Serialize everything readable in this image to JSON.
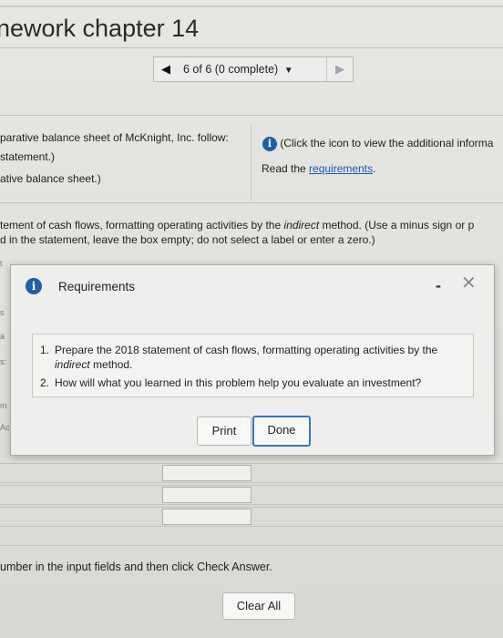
{
  "header": {
    "title": "nework chapter 14"
  },
  "nav": {
    "position": "6 of 6 (0 complete)",
    "prev_icon": "triangle-left",
    "next_icon": "triangle-right",
    "caret_icon": "caret-down"
  },
  "info": {
    "left_line1": "parative balance sheet of McKnight, Inc. follow:",
    "left_line2": "statement.)",
    "left_line3": "ative balance sheet.)",
    "right_line1": "(Click the icon to view the additional informa",
    "right_line2_prefix": "Read the ",
    "right_link": "requirements",
    "right_line2_suffix": "."
  },
  "instructions": {
    "line1_a": "tement of cash flows, formatting operating activities by the ",
    "line1_em": "indirect",
    "line1_b": " method. (Use a minus sign or p",
    "line2": "d in the statement, leave the box empty; do not select a label or enter a zero.)"
  },
  "left_stubs": {
    "s1": "t",
    "s2": "s",
    "s3": "a",
    "s4": "s:",
    "s5": "m",
    "s6": "Ac"
  },
  "modal": {
    "title": "Requirements",
    "minimize": "-",
    "close": "✕",
    "requirements": [
      {
        "num": "1.",
        "text_a": "Prepare the 2018 statement of cash flows, formatting operating activities by the ",
        "em": "indirect",
        "text_b": " method."
      },
      {
        "num": "2.",
        "text_a": "How will what you learned in this problem help you evaluate an investment?",
        "em": "",
        "text_b": ""
      }
    ],
    "print_label": "Print",
    "done_label": "Done"
  },
  "footer": {
    "hint": "umber in the input fields and then click Check Answer.",
    "clear_all": "Clear All"
  },
  "colors": {
    "accent": "#1f5fa8",
    "link": "#1c59b3",
    "done_border": "#3a72c4"
  }
}
